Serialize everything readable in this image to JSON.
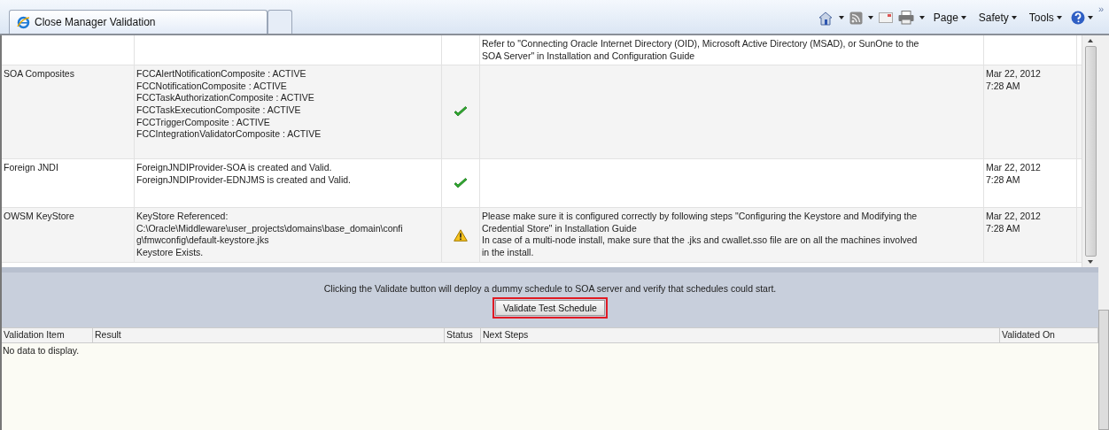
{
  "browser": {
    "tabs": [
      {
        "kind": "page",
        "label": "Close Manager Validation",
        "selected": true
      },
      {
        "kind": "new",
        "selected": false
      }
    ],
    "toolbar": [
      {
        "kind": "home"
      },
      {
        "kind": "caret"
      },
      {
        "kind": "feed"
      },
      {
        "kind": "caret"
      },
      {
        "kind": "mail"
      },
      {
        "kind": "print"
      },
      {
        "kind": "caret"
      },
      {
        "kind": "menu",
        "label": "Page"
      },
      {
        "kind": "menu",
        "label": "Safety"
      },
      {
        "kind": "menu",
        "label": "Tools"
      },
      {
        "kind": "help"
      }
    ],
    "overflow": "»"
  },
  "validation_table": {
    "rows": [
      {
        "item": "",
        "result": [],
        "kind": "blank",
        "next_steps": [
          "Refer to \"Connecting Oracle Internet Directory (OID), Microsoft Active Directory (MSAD), or SunOne to the",
          "SOA Server\" in Installation and Configuration Guide"
        ],
        "validated_on": []
      },
      {
        "item": "SOA Composites",
        "result": [
          "FCCAlertNotificationComposite : ACTIVE",
          "FCCNotificationComposite : ACTIVE",
          "FCCTaskAuthorizationComposite : ACTIVE",
          "FCCTaskExecutionComposite : ACTIVE",
          "FCCTriggerComposite : ACTIVE",
          "FCCIntegrationValidatorComposite : ACTIVE"
        ],
        "kind": "ok",
        "next_steps": [],
        "validated_on": [
          "Mar 22, 2012",
          "7:28 AM"
        ]
      },
      {
        "item": "Foreign JNDI",
        "result": [
          "ForeignJNDIProvider-SOA is created and Valid.",
          "ForeignJNDIProvider-EDNJMS is created and Valid."
        ],
        "kind": "ok",
        "next_steps": [],
        "validated_on": [
          "Mar 22, 2012",
          "7:28 AM"
        ]
      },
      {
        "item": "OWSM KeyStore",
        "result": [
          "KeyStore Referenced:",
          "C:\\Oracle\\Middleware\\user_projects\\domains\\base_domain\\confi",
          "g\\fmwconfig\\default-keystore.jks",
          "Keystore Exists."
        ],
        "kind": "warning",
        "next_steps": [
          "Please make sure it is configured correctly by following steps \"Configuring the Keystore and Modifying the",
          "Credential Store\" in Installation Guide",
          "In case of a multi-node install, make sure that the .jks and cwallet.sso file are on all the machines involved",
          "in the install."
        ],
        "validated_on": [
          "Mar 22, 2012",
          "7:28 AM"
        ]
      }
    ]
  },
  "schedule_panel": {
    "message": "Clicking the Validate button will deploy a dummy schedule to SOA server and verify that schedules could start.",
    "button": "Validate Test Schedule"
  },
  "schedule_table": {
    "columns": [
      "Validation Item",
      "Result",
      "Status",
      "Next Steps",
      "Validated On"
    ],
    "empty_message": "No data to display."
  }
}
